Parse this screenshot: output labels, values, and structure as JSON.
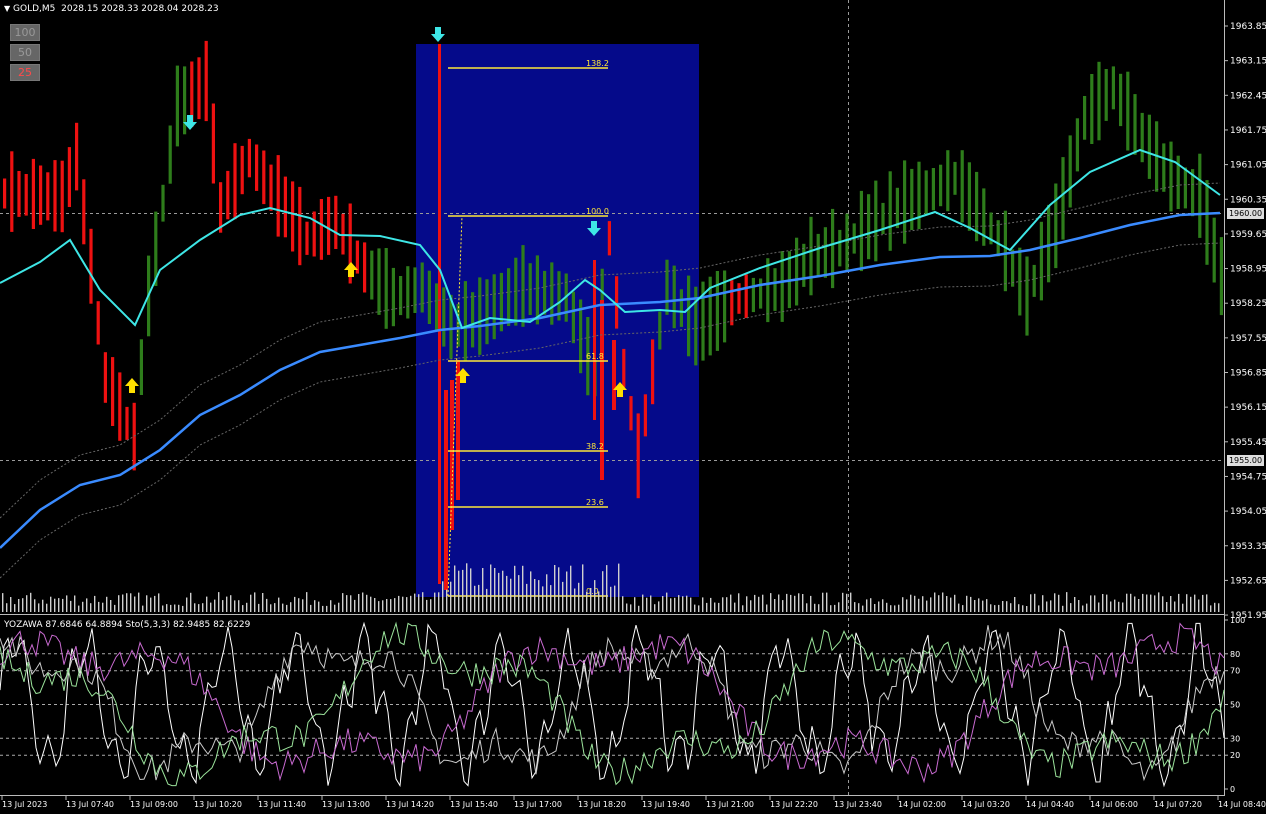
{
  "header": {
    "symbol_timeframe": "GOLD,M5",
    "ohlc": "2028.15 2028.33 2028.04 2028.23",
    "indicator_line": "YOZAWA 87.6846 64.8894  Sto(5,3,3) 82.9485 82.6229"
  },
  "buttons": [
    "100",
    "50",
    "25"
  ],
  "price_axis": [
    "1963.85",
    "1963.15",
    "1962.45",
    "1961.75",
    "1961.05",
    "1960.35",
    "1959.65",
    "1958.95",
    "1958.25",
    "1957.55",
    "1956.85",
    "1956.15",
    "1955.45",
    "1954.75",
    "1954.05",
    "1953.35",
    "1952.65",
    "1951.95"
  ],
  "price_tags": {
    "upper": "1960.00",
    "lower": "1955.00"
  },
  "osc_axis": [
    "100",
    "80",
    "70",
    "50",
    "30",
    "20",
    "0"
  ],
  "time_axis": [
    "13 Jul 2023",
    "13 Jul 07:40",
    "13 Jul 09:00",
    "13 Jul 10:20",
    "13 Jul 11:40",
    "13 Jul 13:00",
    "13 Jul 14:20",
    "13 Jul 15:40",
    "13 Jul 17:00",
    "13 Jul 18:20",
    "13 Jul 19:40",
    "13 Jul 21:00",
    "13 Jul 22:20",
    "13 Jul 23:40",
    "14 Jul 02:00",
    "14 Jul 03:20",
    "14 Jul 04:40",
    "14 Jul 06:00",
    "14 Jul 07:20",
    "14 Jul 08:40"
  ],
  "fib_levels": [
    "138.2",
    "100.0",
    "61.8",
    "38.2",
    "23.6",
    "0.0"
  ],
  "colors": {
    "bull": "#2e7d1b",
    "bear": "#ee1111",
    "fib_zone": "#050a8a",
    "fib_line": "#ffe83a",
    "ma_fast": "#3ee6e6",
    "ma_slow": "#3a8bff",
    "arrow_up": "#ffe000",
    "arrow_down": "#3ee6e6"
  },
  "chart_data": {
    "type": "candlestick",
    "y_range": [
      1951.95,
      1964.2
    ],
    "osc_range": [
      0,
      100
    ],
    "osc_levels": [
      80,
      70,
      50,
      30,
      20
    ]
  }
}
